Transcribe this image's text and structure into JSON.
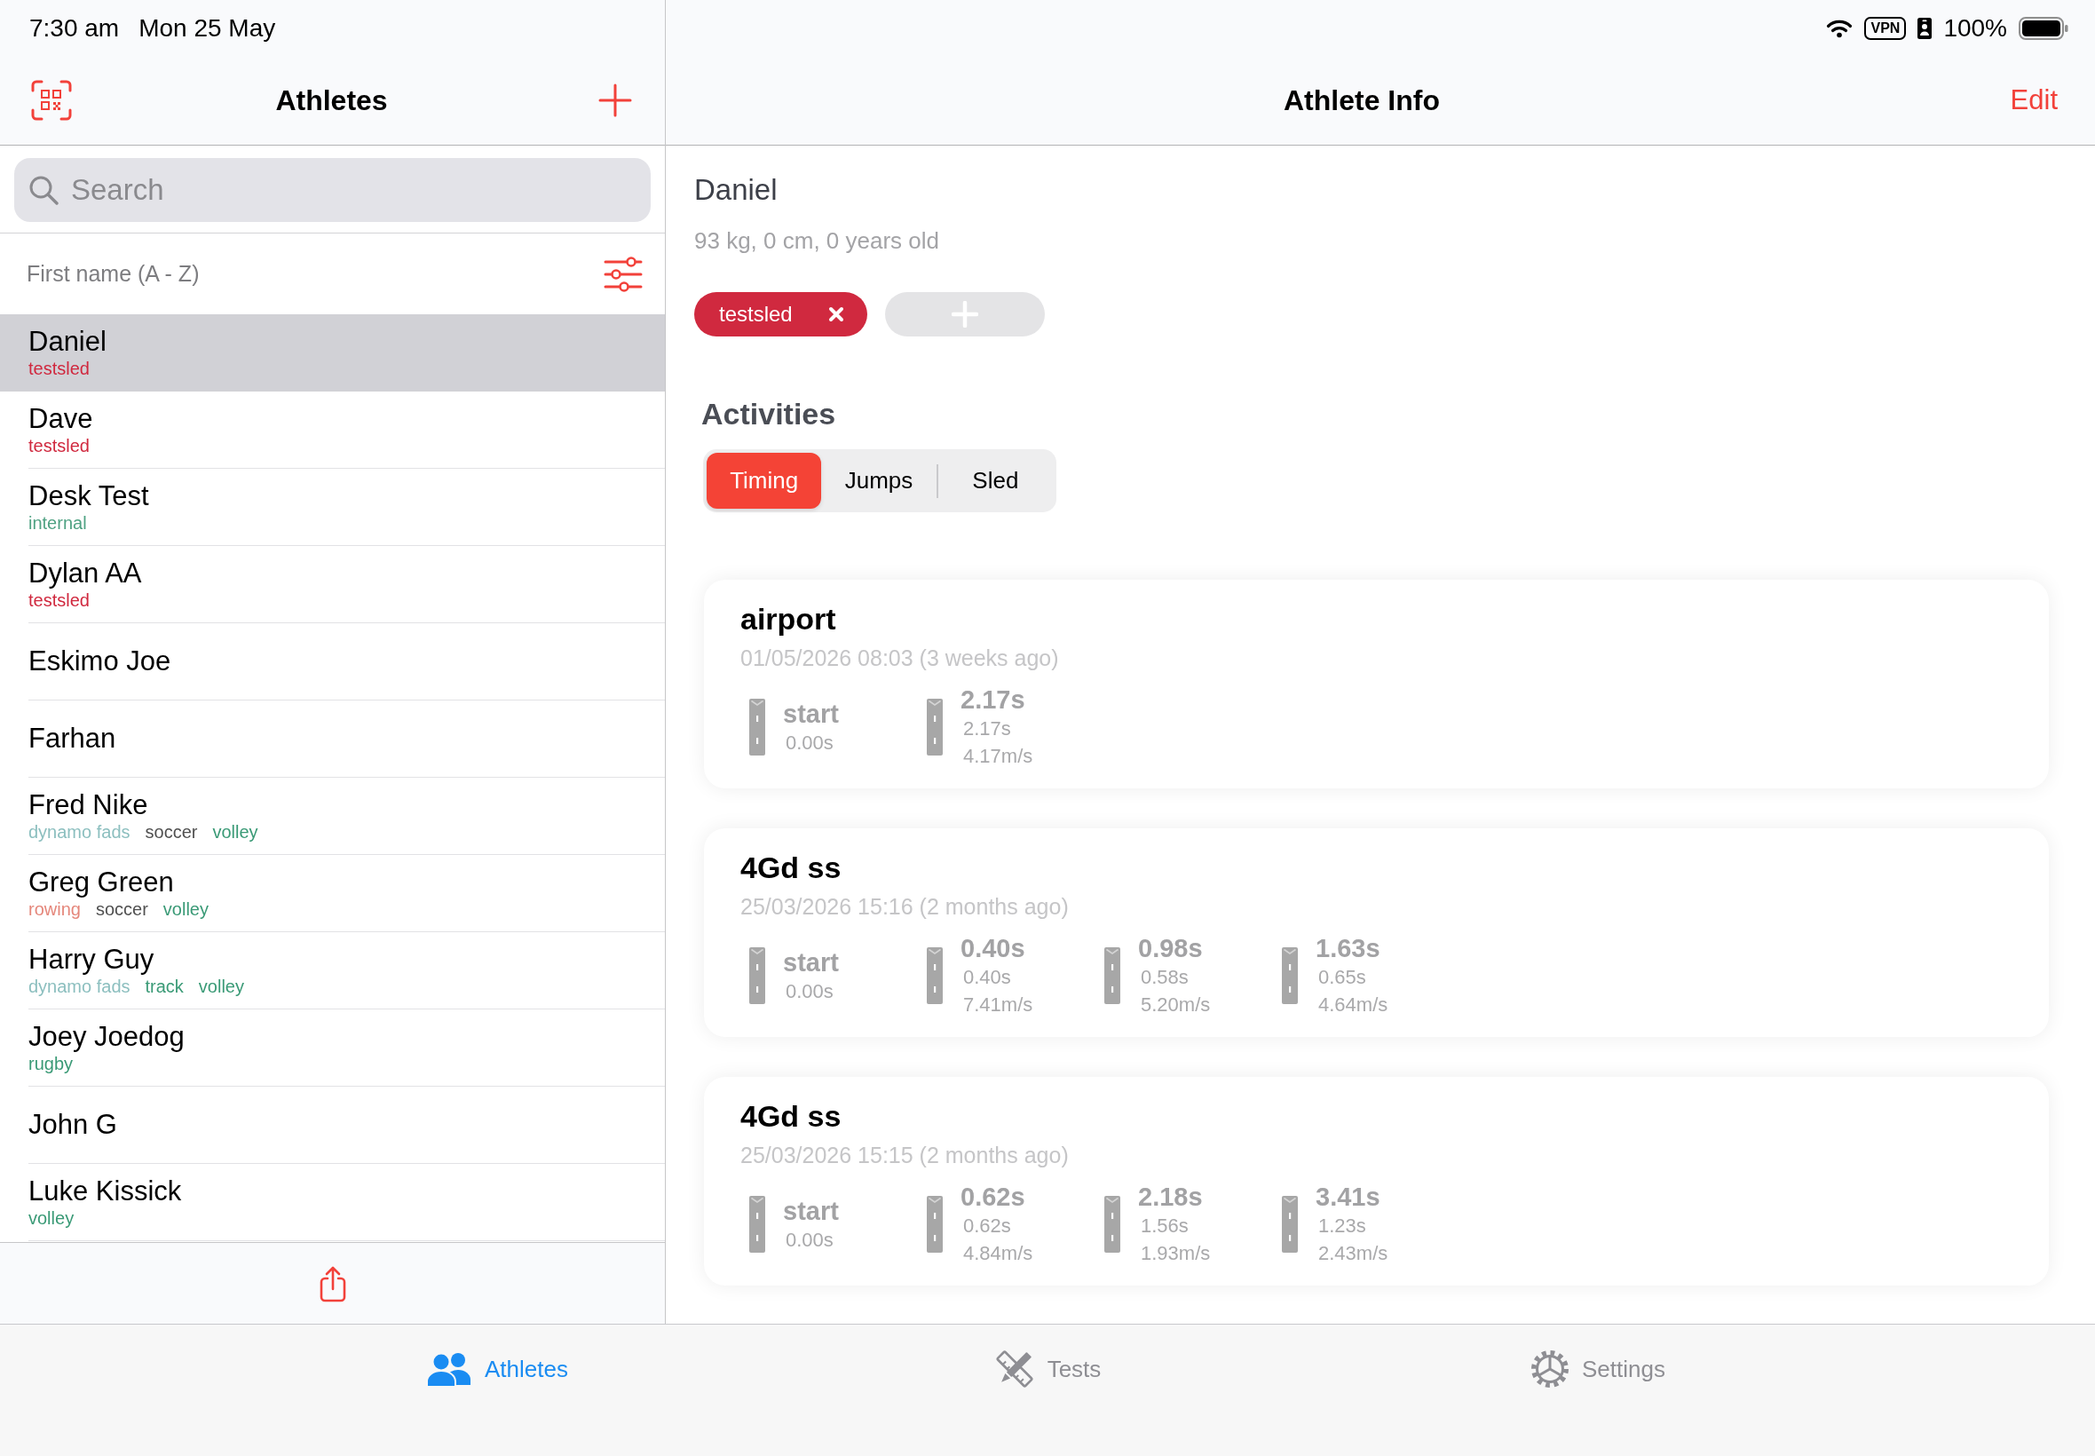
{
  "status_bar": {
    "time": "7:30 am",
    "date": "Mon 25 May",
    "vpn": "VPN",
    "battery": "100%"
  },
  "sidebar": {
    "title": "Athletes",
    "search": {
      "placeholder": "Search"
    },
    "sort_label": "First name (A - Z)",
    "athletes": [
      {
        "name": "Daniel",
        "selected": true,
        "tags": [
          {
            "label": "testsled",
            "color": "#d0283e"
          }
        ]
      },
      {
        "name": "Dave",
        "selected": false,
        "tags": [
          {
            "label": "testsled",
            "color": "#d0283e"
          }
        ]
      },
      {
        "name": "Desk Test",
        "selected": false,
        "tags": [
          {
            "label": "internal",
            "color": "#4fa283"
          }
        ]
      },
      {
        "name": "Dylan AA",
        "selected": false,
        "tags": [
          {
            "label": "testsled",
            "color": "#d0283e"
          }
        ]
      },
      {
        "name": "Eskimo Joe",
        "selected": false
      },
      {
        "name": "Farhan",
        "selected": false
      },
      {
        "name": "Fred Nike",
        "selected": false,
        "tags": [
          {
            "label": "dynamo fads",
            "color": "#8cbfbf"
          },
          {
            "label": "soccer",
            "color": "#505050"
          },
          {
            "label": "volley",
            "color": "#3a9a76"
          }
        ]
      },
      {
        "name": "Greg Green",
        "selected": false,
        "tags": [
          {
            "label": "rowing",
            "color": "#e5877b"
          },
          {
            "label": "soccer",
            "color": "#505050"
          },
          {
            "label": "volley",
            "color": "#3a9a76"
          }
        ]
      },
      {
        "name": "Harry Guy",
        "selected": false,
        "tags": [
          {
            "label": "dynamo fads",
            "color": "#8cbfbf"
          },
          {
            "label": "track",
            "color": "#3a9a76"
          },
          {
            "label": "volley",
            "color": "#3a9a76"
          }
        ]
      },
      {
        "name": "Joey Joedog",
        "selected": false,
        "tags": [
          {
            "label": "rugby",
            "color": "#3a9a76"
          }
        ]
      },
      {
        "name": "John G",
        "selected": false
      },
      {
        "name": "Luke Kissick",
        "selected": false,
        "tags": [
          {
            "label": "volley",
            "color": "#3a9a76"
          }
        ]
      }
    ]
  },
  "detail": {
    "title": "Athlete Info",
    "edit": "Edit",
    "athlete": {
      "name": "Daniel",
      "summary": "93 kg, 0 cm, 0 years old",
      "tags": [
        {
          "label": "testsled",
          "color": "#d0293f"
        }
      ]
    },
    "activities": {
      "heading": "Activities",
      "segments": [
        {
          "label": "Timing",
          "selected": true
        },
        {
          "label": "Jumps",
          "selected": false
        },
        {
          "label": "Sled",
          "selected": false
        }
      ],
      "sessions": [
        {
          "title": "airport",
          "date": "01/05/2026 08:03 (3 weeks ago)",
          "splits": [
            {
              "label": "start",
              "time": "0.00s"
            },
            {
              "label": "2.17s",
              "time": "2.17s",
              "speed": "4.17m/s"
            }
          ]
        },
        {
          "title": "4Gd ss",
          "date": "25/03/2026 15:16 (2 months ago)",
          "splits": [
            {
              "label": "start",
              "time": "0.00s"
            },
            {
              "label": "0.40s",
              "time": "0.40s",
              "speed": "7.41m/s"
            },
            {
              "label": "0.98s",
              "time": "0.58s",
              "speed": "5.20m/s"
            },
            {
              "label": "1.63s",
              "time": "0.65s",
              "speed": "4.64m/s"
            }
          ]
        },
        {
          "title": "4Gd ss",
          "date": "25/03/2026 15:15 (2 months ago)",
          "splits": [
            {
              "label": "start",
              "time": "0.00s"
            },
            {
              "label": "0.62s",
              "time": "0.62s",
              "speed": "4.84m/s"
            },
            {
              "label": "2.18s",
              "time": "1.56s",
              "speed": "1.93m/s"
            },
            {
              "label": "3.41s",
              "time": "1.23s",
              "speed": "2.43m/s"
            }
          ]
        }
      ]
    }
  },
  "tab_bar": [
    {
      "label": "Athletes",
      "selected": true
    },
    {
      "label": "Tests",
      "selected": false
    },
    {
      "label": "Settings",
      "selected": false
    }
  ]
}
